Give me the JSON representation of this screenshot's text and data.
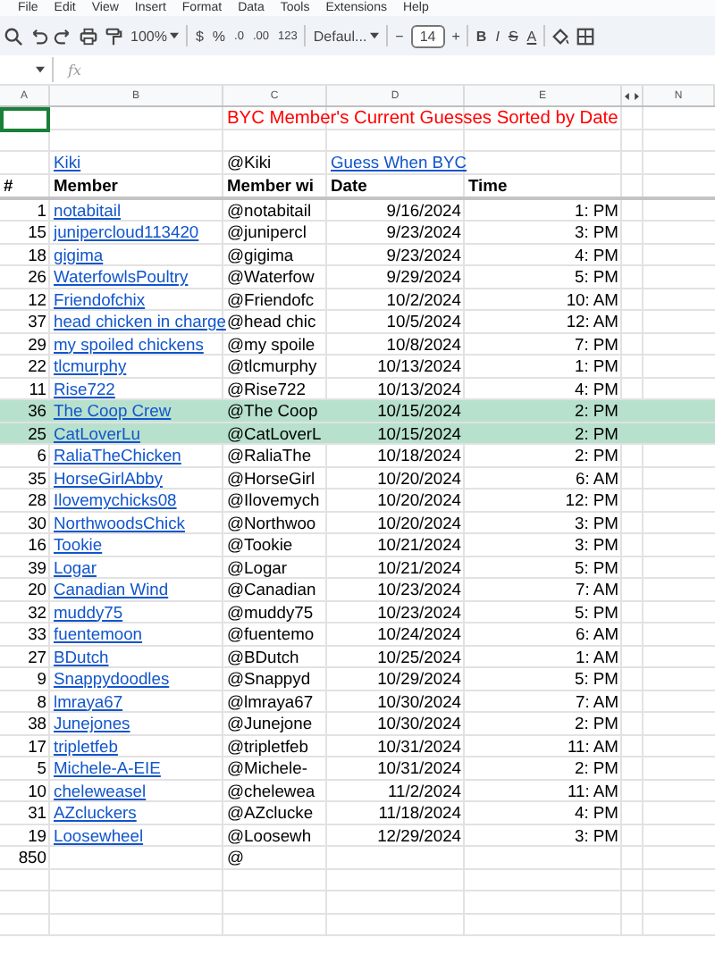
{
  "menu": [
    "File",
    "Edit",
    "View",
    "Insert",
    "Format",
    "Data",
    "Tools",
    "Extensions",
    "Help"
  ],
  "toolbar": {
    "zoom": "100%",
    "currency": "$",
    "percent": "%",
    "decrease_decimal": ".0",
    "increase_decimal": ".00",
    "number_format": "123",
    "font": "Defaul...",
    "font_size_minus": "−",
    "font_size": "14",
    "font_size_plus": "+",
    "bold": "B",
    "italic": "I",
    "strikethrough": "S",
    "text_color": "A"
  },
  "formula_bar": {
    "fx": "fx"
  },
  "columns": [
    "A",
    "B",
    "C",
    "D",
    "E",
    "N"
  ],
  "sheet": {
    "a1_selected": true,
    "title": "BYC Member's Current Guesses Sorted by Date",
    "link_row": {
      "member": "Kiki",
      "handle": "@Kiki",
      "link": "Guess When BYC"
    },
    "header": {
      "num": "#",
      "member": "Member",
      "handle": "Member wi",
      "date": "Date",
      "time": "Time"
    },
    "rows": [
      {
        "num": "1",
        "member": "notabitail",
        "handle": "@notabitail",
        "date": "9/16/2024",
        "time": "1: PM",
        "highlighted": false
      },
      {
        "num": "15",
        "member": "junipercloud113420",
        "handle": "@junipercl",
        "date": "9/23/2024",
        "time": "3: PM",
        "highlighted": false
      },
      {
        "num": "18",
        "member": "gigima",
        "handle": "@gigima",
        "date": "9/23/2024",
        "time": "4: PM",
        "highlighted": false
      },
      {
        "num": "26",
        "member": "WaterfowlsPoultry",
        "handle": "@Waterfow",
        "date": "9/29/2024",
        "time": "5: PM",
        "highlighted": false
      },
      {
        "num": "12",
        "member": "Friendofchix",
        "handle": "@Friendofc",
        "date": "10/2/2024",
        "time": "10: AM",
        "highlighted": false
      },
      {
        "num": "37",
        "member": "head chicken in charge",
        "handle": "@head chic",
        "date": "10/5/2024",
        "time": "12: AM",
        "highlighted": false
      },
      {
        "num": "29",
        "member": "my spoiled chickens",
        "handle": "@my spoile",
        "date": "10/8/2024",
        "time": "7: PM",
        "highlighted": false
      },
      {
        "num": "22",
        "member": "tlcmurphy",
        "handle": "@tlcmurphy",
        "date": "10/13/2024",
        "time": "1: PM",
        "highlighted": false
      },
      {
        "num": "11",
        "member": "Rise722",
        "handle": "@Rise722",
        "date": "10/13/2024",
        "time": "4: PM",
        "highlighted": false
      },
      {
        "num": "36",
        "member": "The Coop Crew",
        "handle": "@The Coop",
        "date": "10/15/2024",
        "time": "2: PM",
        "highlighted": true
      },
      {
        "num": "25",
        "member": "CatLoverLu",
        "handle": "@CatLoverL",
        "date": "10/15/2024",
        "time": "2: PM",
        "highlighted": true
      },
      {
        "num": "6",
        "member": "RaliaTheChicken",
        "handle": "@RaliaThe",
        "date": "10/18/2024",
        "time": "2: PM",
        "highlighted": false
      },
      {
        "num": "35",
        "member": "HorseGirlAbby",
        "handle": "@HorseGirl",
        "date": "10/20/2024",
        "time": "6: AM",
        "highlighted": false
      },
      {
        "num": "28",
        "member": "Ilovemychicks08",
        "handle": "@Ilovemych",
        "date": "10/20/2024",
        "time": "12: PM",
        "highlighted": false
      },
      {
        "num": "30",
        "member": "NorthwoodsChick",
        "handle": "@Northwoo",
        "date": "10/20/2024",
        "time": "3: PM",
        "highlighted": false
      },
      {
        "num": "16",
        "member": "Tookie",
        "handle": "@Tookie",
        "date": "10/21/2024",
        "time": "3: PM",
        "highlighted": false
      },
      {
        "num": "39",
        "member": "Logar",
        "handle": "@Logar",
        "date": "10/21/2024",
        "time": "5: PM",
        "highlighted": false
      },
      {
        "num": "20",
        "member": "Canadian Wind",
        "handle": "@Canadian",
        "date": "10/23/2024",
        "time": "7: AM",
        "highlighted": false
      },
      {
        "num": "32",
        "member": "muddy75",
        "handle": "@muddy75",
        "date": "10/23/2024",
        "time": "5: PM",
        "highlighted": false
      },
      {
        "num": "33",
        "member": "fuentemoon",
        "handle": "@fuentemo",
        "date": "10/24/2024",
        "time": "6: AM",
        "highlighted": false
      },
      {
        "num": "27",
        "member": "BDutch",
        "handle": "@BDutch",
        "date": "10/25/2024",
        "time": "1: AM",
        "highlighted": false
      },
      {
        "num": "9",
        "member": "Snappydoodles",
        "handle": "@Snappyd",
        "date": "10/29/2024",
        "time": "5: PM",
        "highlighted": false
      },
      {
        "num": "8",
        "member": "lmraya67",
        "handle": "@lmraya67",
        "date": "10/30/2024",
        "time": "7: AM",
        "highlighted": false
      },
      {
        "num": "38",
        "member": "Junejones",
        "handle": "@Junejone",
        "date": "10/30/2024",
        "time": "2: PM",
        "highlighted": false
      },
      {
        "num": "17",
        "member": "tripletfeb",
        "handle": "@tripletfeb",
        "date": "10/31/2024",
        "time": "11: AM",
        "highlighted": false
      },
      {
        "num": "5",
        "member": "Michele-A-EIE",
        "handle": "@Michele-",
        "date": "10/31/2024",
        "time": "2: PM",
        "highlighted": false
      },
      {
        "num": "10",
        "member": "cheleweasel",
        "handle": "@chelewea",
        "date": "11/2/2024",
        "time": "11: AM",
        "highlighted": false
      },
      {
        "num": "31",
        "member": "AZcluckers",
        "handle": "@AZclucke",
        "date": "11/18/2024",
        "time": "4: PM",
        "highlighted": false
      },
      {
        "num": "19",
        "member": "Loosewheel",
        "handle": "@Loosewh",
        "date": "12/29/2024",
        "time": "3: PM",
        "highlighted": false
      }
    ],
    "footer": {
      "num": "850",
      "handle": "@"
    }
  }
}
